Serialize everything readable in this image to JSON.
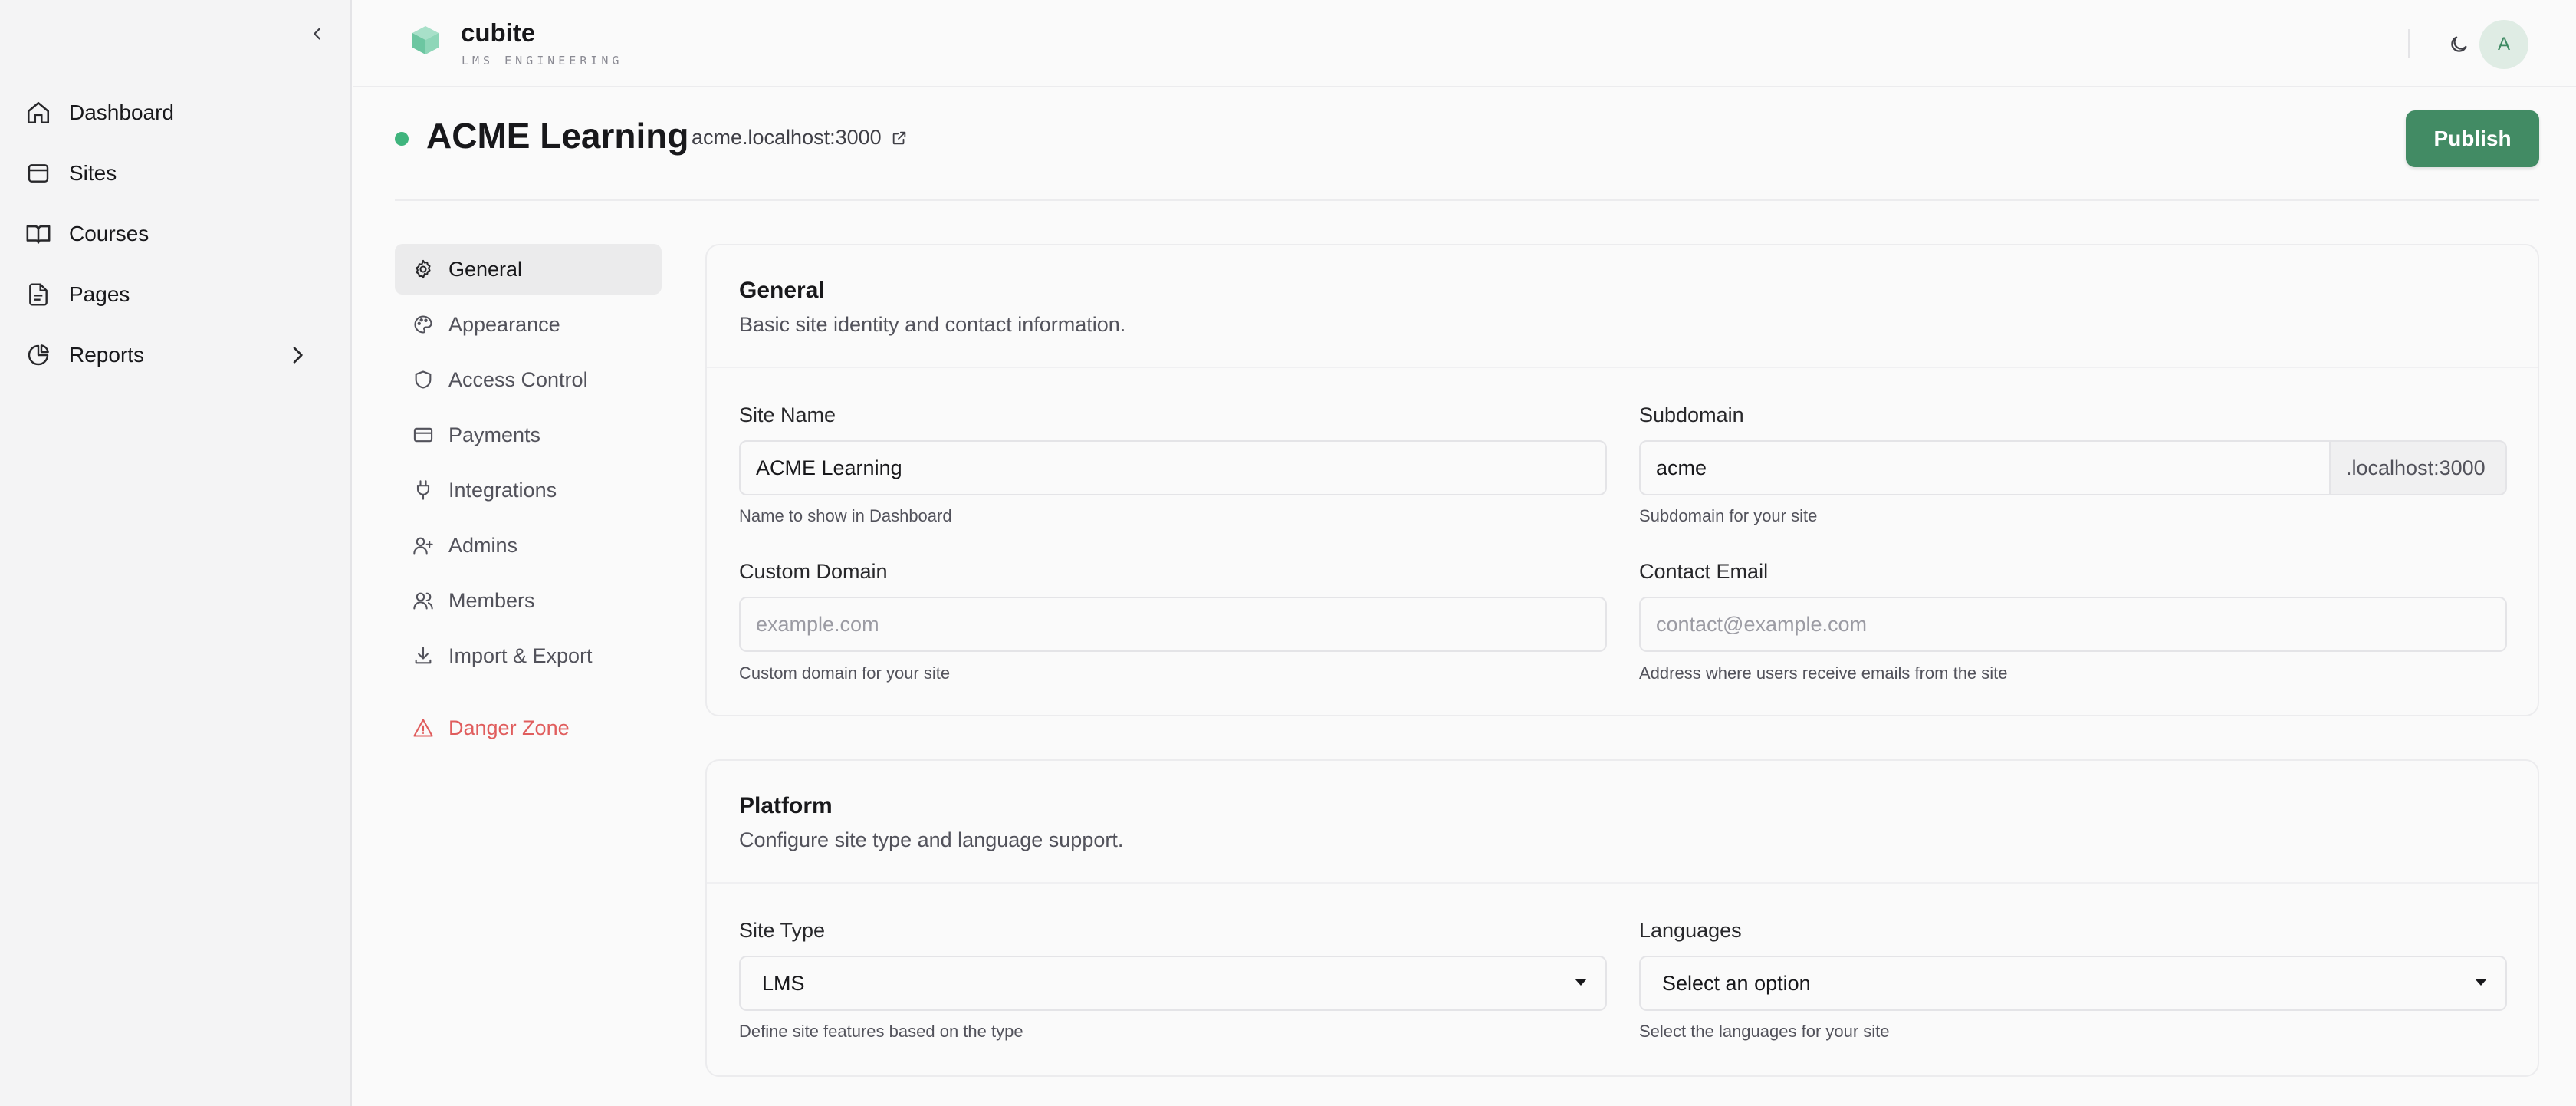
{
  "sidebar": {
    "collapse_icon": "chevron-left-icon",
    "items": [
      {
        "label": "Dashboard",
        "icon": "home-icon"
      },
      {
        "label": "Sites",
        "icon": "browser-window-icon"
      },
      {
        "label": "Courses",
        "icon": "open-book-icon"
      },
      {
        "label": "Pages",
        "icon": "file-text-icon"
      },
      {
        "label": "Reports",
        "icon": "pie-chart-icon",
        "has_children": true
      }
    ]
  },
  "header": {
    "brand_name": "cubite",
    "brand_subtitle": "LMS ENGINEERING",
    "theme_icon": "moon-icon",
    "avatar_initial": "A"
  },
  "page": {
    "title": "ACME Learning",
    "site_url": "acme.localhost:3000",
    "status_color": "#3fb47d",
    "publish_label": "Publish",
    "accent_color": "#428b64"
  },
  "settings_nav": {
    "items": [
      {
        "label": "General",
        "icon": "gear-icon",
        "active": true
      },
      {
        "label": "Appearance",
        "icon": "palette-icon"
      },
      {
        "label": "Access Control",
        "icon": "shield-icon"
      },
      {
        "label": "Payments",
        "icon": "credit-card-icon"
      },
      {
        "label": "Integrations",
        "icon": "plug-icon"
      },
      {
        "label": "Admins",
        "icon": "user-plus-icon"
      },
      {
        "label": "Members",
        "icon": "users-icon"
      },
      {
        "label": "Import & Export",
        "icon": "download-icon"
      }
    ],
    "danger": {
      "label": "Danger Zone",
      "icon": "warning-triangle-icon",
      "color": "#e05d5d"
    }
  },
  "general": {
    "title": "General",
    "description": "Basic site identity and contact information.",
    "site_name": {
      "label": "Site Name",
      "value": "ACME Learning",
      "help": "Name to show in Dashboard"
    },
    "subdomain": {
      "label": "Subdomain",
      "value": "acme",
      "suffix": ".localhost:3000",
      "help": "Subdomain for your site"
    },
    "custom_domain": {
      "label": "Custom Domain",
      "value": "",
      "placeholder": "example.com",
      "help": "Custom domain for your site"
    },
    "contact_email": {
      "label": "Contact Email",
      "value": "",
      "placeholder": "contact@example.com",
      "help": "Address where users receive emails from the site"
    }
  },
  "platform": {
    "title": "Platform",
    "description": "Configure site type and language support.",
    "site_type": {
      "label": "Site Type",
      "selected": "LMS",
      "help": "Define site features based on the type"
    },
    "languages": {
      "label": "Languages",
      "selected": "Select an option",
      "help": "Select the languages for your site"
    }
  }
}
